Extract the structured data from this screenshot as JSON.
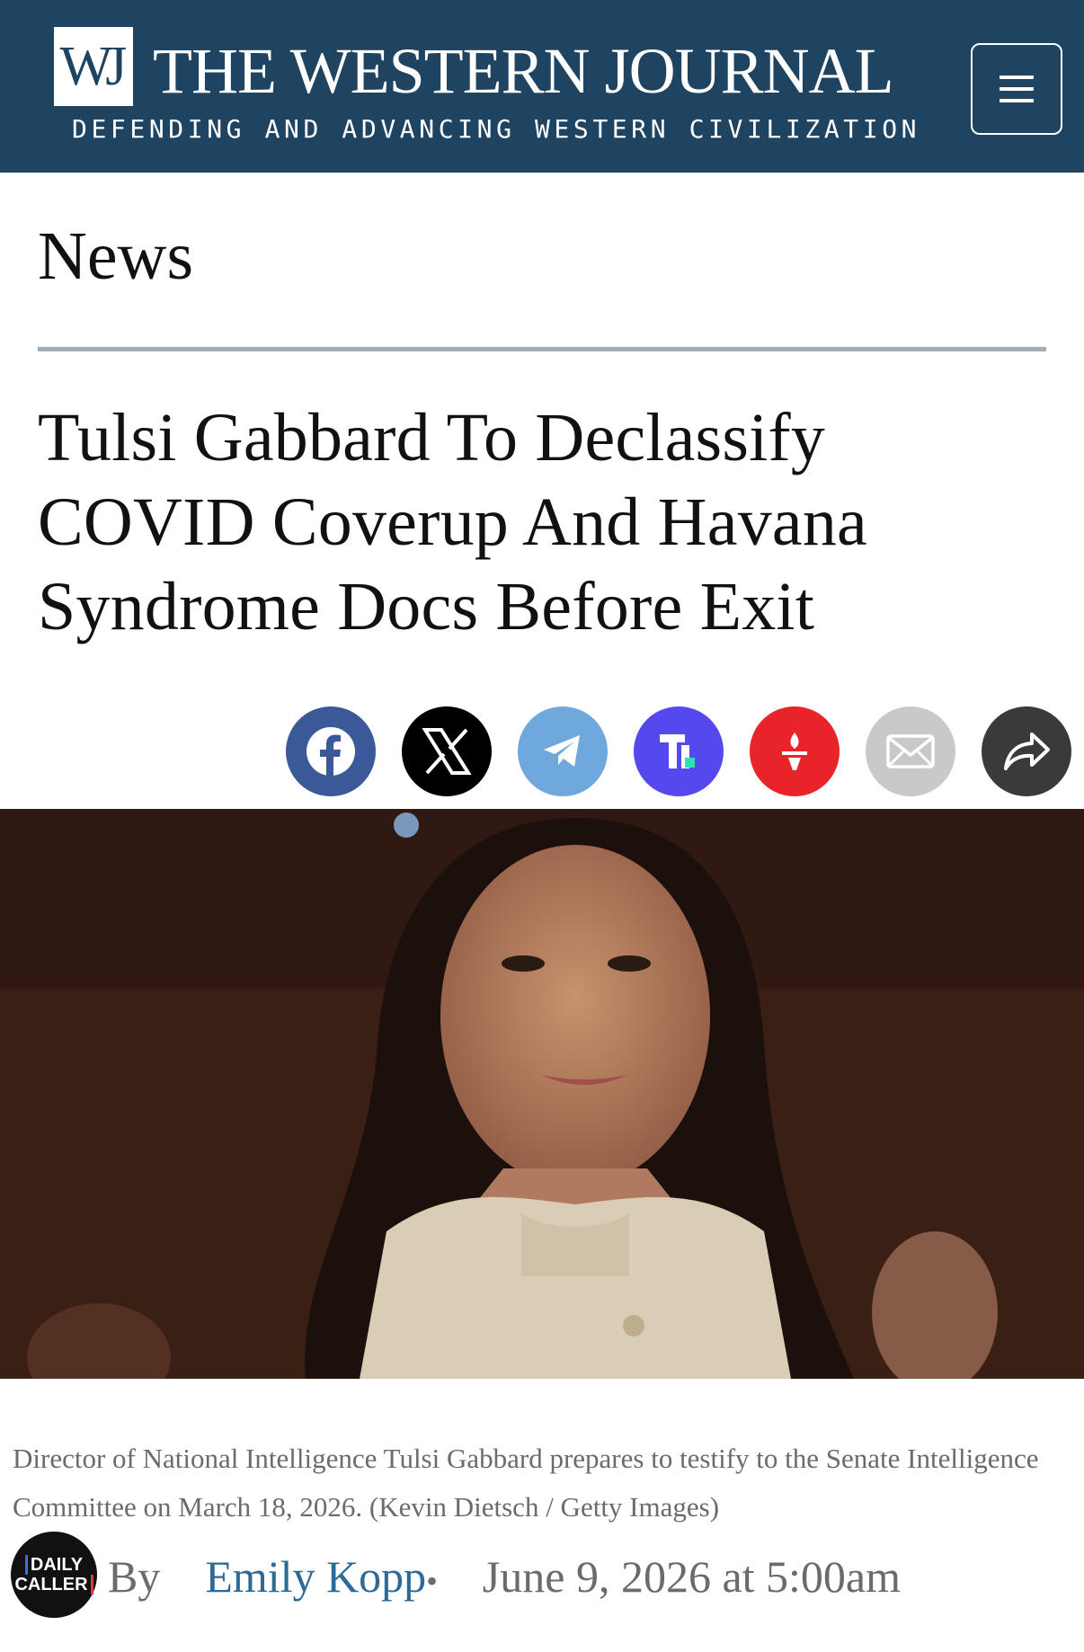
{
  "header": {
    "logo_text": "WJ",
    "site_title": "THE WESTERN JOURNAL",
    "tagline": "DEFENDING AND ADVANCING WESTERN CIVILIZATION",
    "menu_icon": "hamburger-menu-icon",
    "background_color": "#1f4462"
  },
  "section": {
    "label": "News"
  },
  "article": {
    "headline": "Tulsi Gabbard To Declassify COVID Coverup And Havana Syndrome Docs Before Exit",
    "caption": "Director of National Intelligence Tulsi Gabbard prepares to testify to the Senate Intelligence Committee on March 18, 2026. (Kevin Dietsch / Getty Images)",
    "byline": {
      "source_logo_text": [
        "DAILY",
        "CALLER"
      ],
      "by_label": "By",
      "author": "Emily Kopp",
      "separator": "•",
      "date": "June 9, 2026 at 5:00am"
    }
  },
  "share_buttons": [
    {
      "name": "facebook",
      "icon": "facebook-icon",
      "color": "#3b5998"
    },
    {
      "name": "x",
      "icon": "x-icon",
      "color": "#000000"
    },
    {
      "name": "telegram",
      "icon": "telegram-icon",
      "color": "#6fa8dc"
    },
    {
      "name": "truth-social",
      "icon": "truth-social-icon",
      "color": "#5448ee"
    },
    {
      "name": "gettr",
      "icon": "gettr-icon",
      "color": "#e8242a"
    },
    {
      "name": "email",
      "icon": "envelope-icon",
      "color": "#c9c9c9"
    },
    {
      "name": "share",
      "icon": "share-arrow-icon",
      "color": "#3a3a3a"
    }
  ],
  "colors": {
    "author_link": "#2d6b96",
    "muted_text": "#6b6b6b",
    "rule": "#9fadb7"
  }
}
